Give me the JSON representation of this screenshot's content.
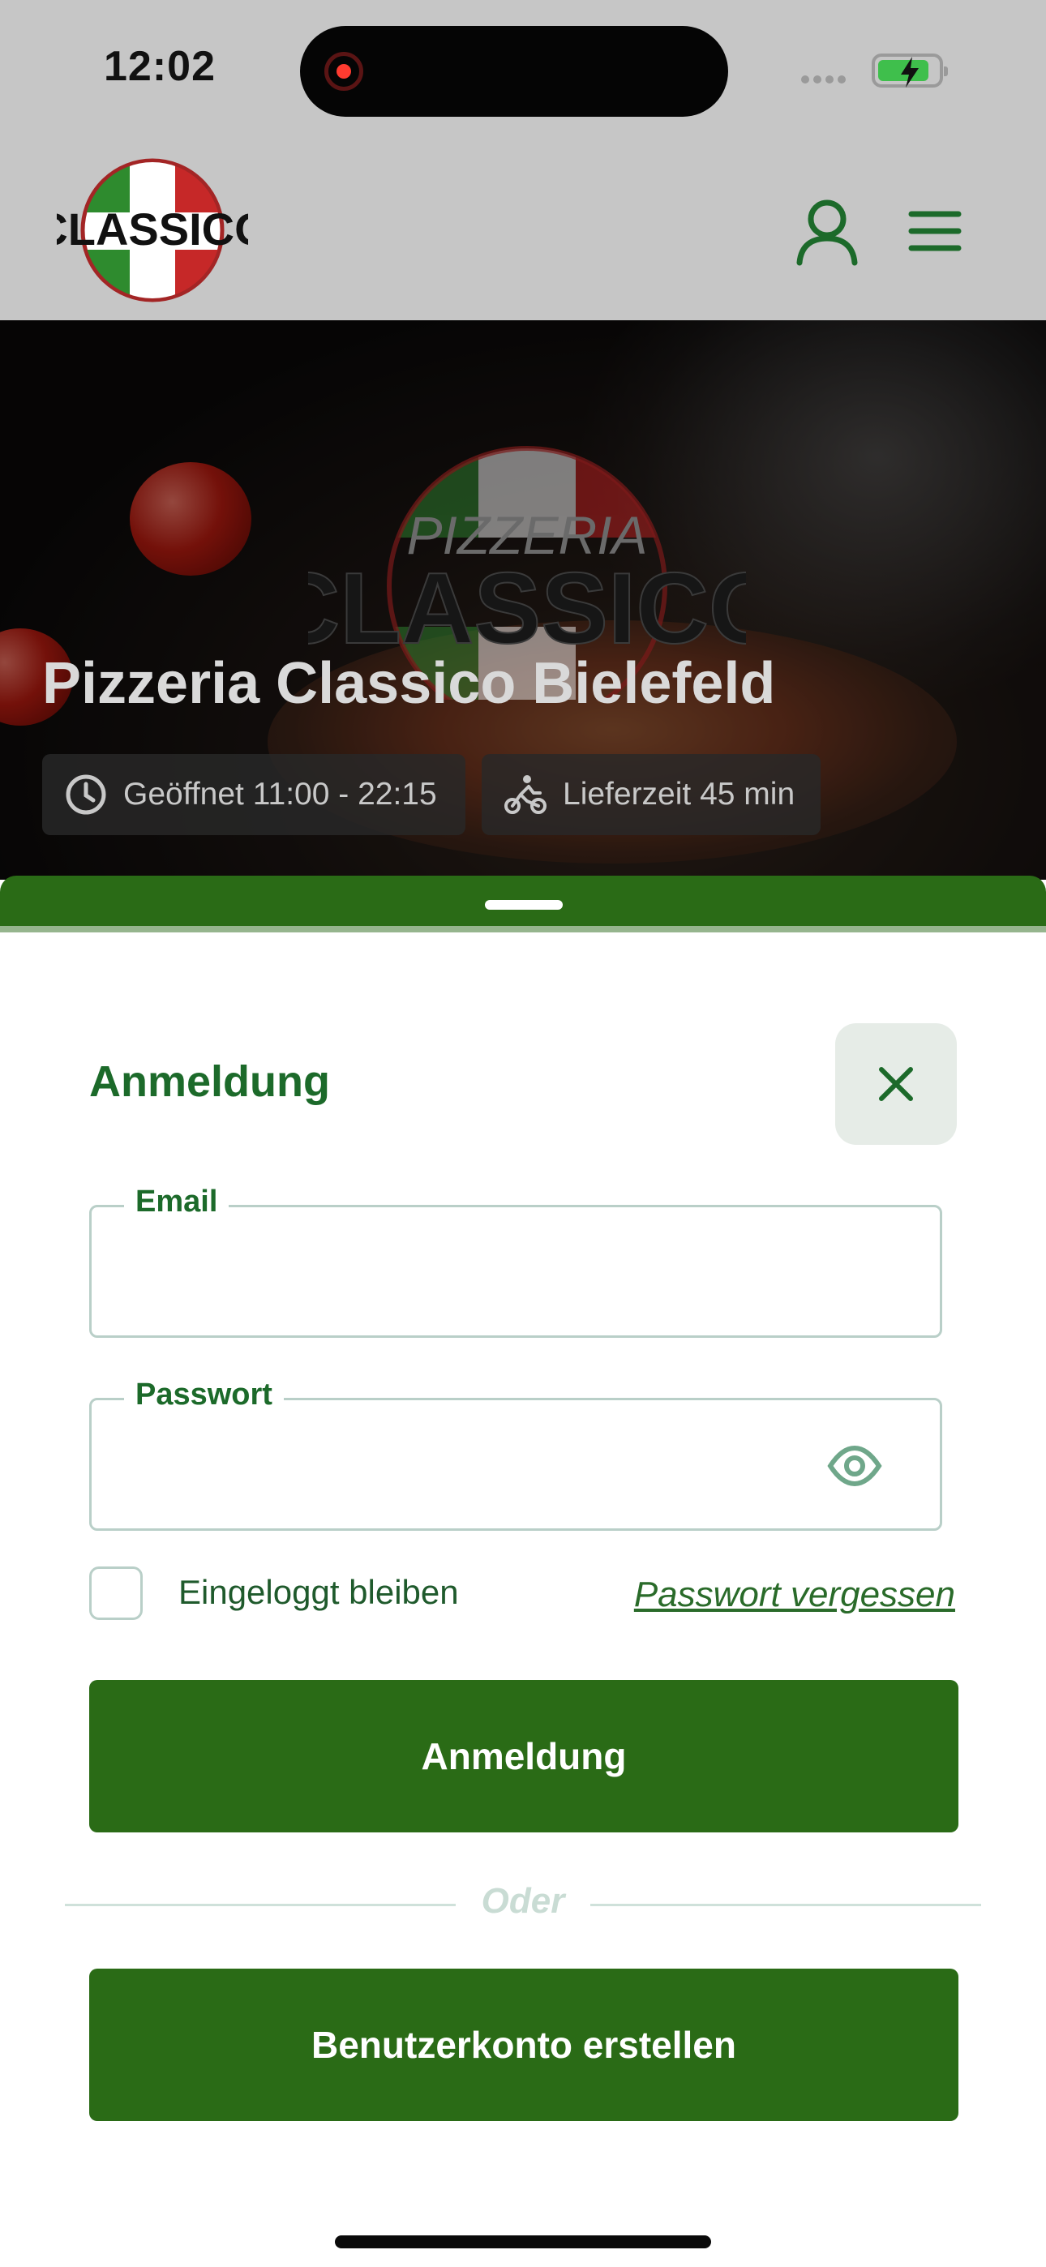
{
  "status_bar": {
    "time": "12:02"
  },
  "header": {
    "logo_text": "CLASSICO"
  },
  "hero": {
    "brand_top": "PIZZERIA",
    "brand_main": "CLASSICO",
    "title": "Pizzeria Classico Bielefeld",
    "opening_hours": "Geöffnet 11:00 - 22:15",
    "delivery_time": "Lieferzeit 45 min"
  },
  "login_modal": {
    "title": "Anmeldung",
    "email_label": "Email",
    "email_value": "",
    "password_label": "Passwort",
    "password_value": "",
    "stay_logged_in": "Eingeloggt bleiben",
    "stay_logged_in_checked": false,
    "forgot_password": "Passwort vergessen",
    "login_button": "Anmeldung",
    "divider_text": "Oder",
    "register_button": "Benutzerkonto erstellen"
  },
  "colors": {
    "brand_green": "#2a6b16",
    "title_green": "#1c6a2a",
    "field_border": "#b9cfc8"
  }
}
